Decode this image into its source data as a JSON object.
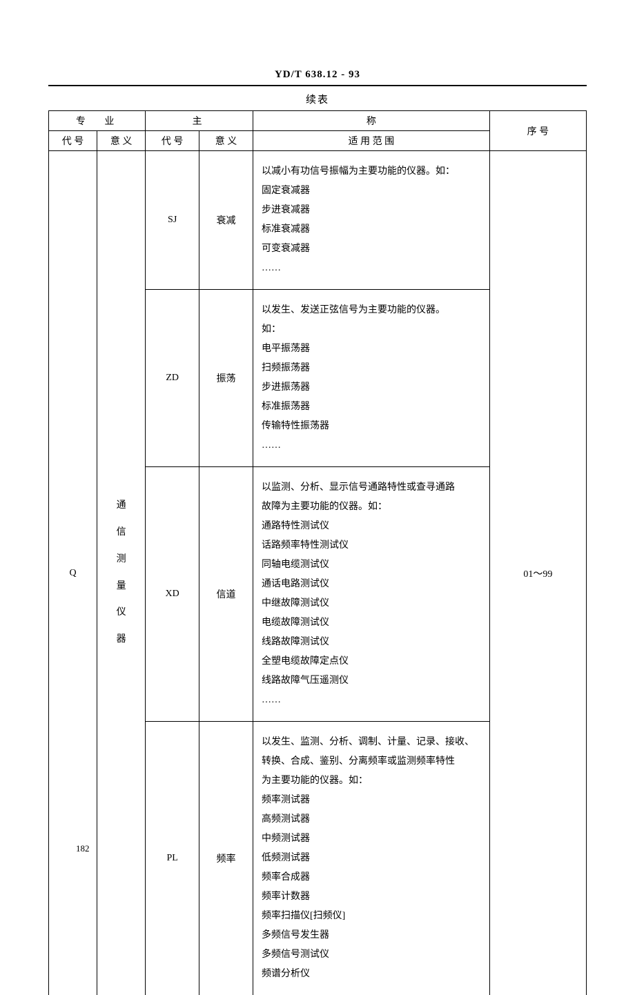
{
  "doc_code": "YD/T 638.12 - 93",
  "table_caption": "续表",
  "headers": {
    "group_specialty": "专 业",
    "group_main": "主",
    "group_title": "称",
    "group_seq": "序 号",
    "code": "代 号",
    "meaning": "意 义",
    "scope": "适 用 范 围"
  },
  "major": {
    "code": "Q",
    "meaning_chars": [
      "通",
      "信",
      "测",
      "量",
      "仪",
      "器"
    ]
  },
  "seq": "01～99",
  "rows": [
    {
      "code": "SJ",
      "meaning": "衰减",
      "scope_lines": [
        "以减小有功信号振幅为主要功能的仪器。如：",
        "固定衰减器",
        "步进衰减器",
        "标准衰减器",
        "可变衰减器",
        "……"
      ]
    },
    {
      "code": "ZD",
      "meaning": "振荡",
      "scope_lines": [
        "以发生、发送正弦信号为主要功能的仪器。",
        "如：",
        "电平振荡器",
        "扫频振荡器",
        "步进振荡器",
        "标准振荡器",
        "传输特性振荡器",
        "……"
      ]
    },
    {
      "code": "XD",
      "meaning": "信道",
      "scope_lines": [
        "以监测、分析、显示信号通路特性或查寻通路",
        "故障为主要功能的仪器。如：",
        "通路特性测试仪",
        "话路频率特性测试仪",
        "同轴电缆测试仪",
        "通话电路测试仪",
        "中继故障测试仪",
        "电缆故障测试仪",
        "线路故障测试仪",
        "全塑电缆故障定点仪",
        "线路故障气压遥测仪",
        "……"
      ]
    },
    {
      "code": "PL",
      "meaning": "频率",
      "scope_lines": [
        "以发生、监测、分析、调制、计量、记录、接收、",
        "转换、合成、鉴别、分离频率或监测频率特性",
        "为主要功能的仪器。如：",
        "频率测试器",
        "高频测试器",
        "中频测试器",
        "低频测试器",
        "频率合成器",
        "频率计数器",
        "频率扫描仪[扫频仪]",
        "多频信号发生器",
        "多频信号测试仪",
        "频谱分析仪"
      ]
    }
  ],
  "page_number": "182"
}
